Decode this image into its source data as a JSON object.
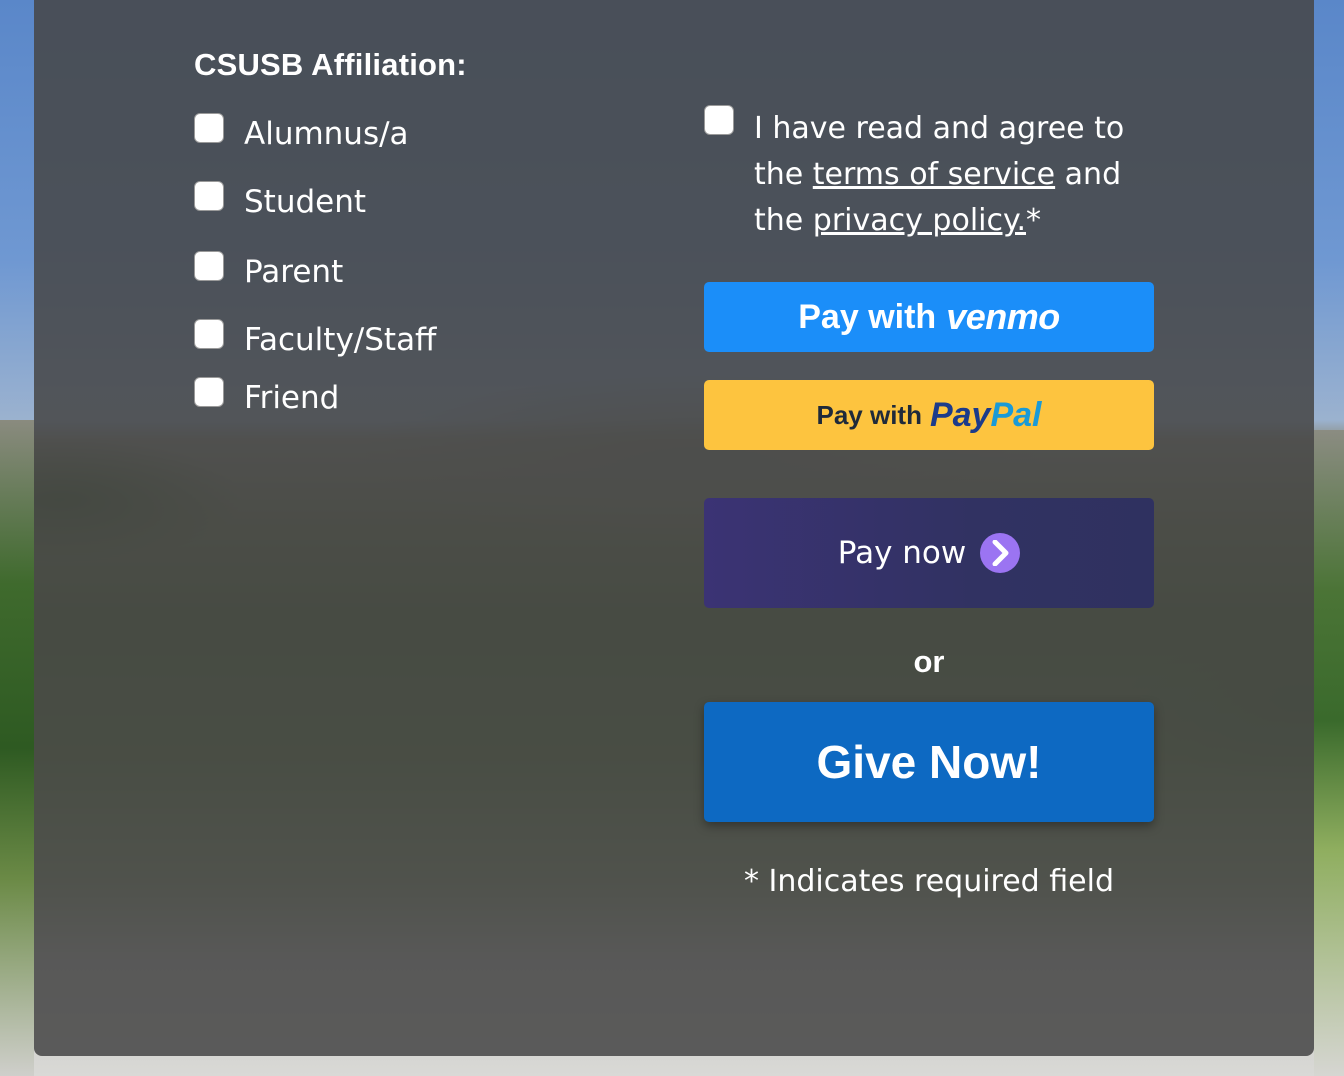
{
  "affiliation": {
    "title": "CSUSB Affiliation:",
    "options": [
      {
        "label": "Alumnus/a",
        "checked": false
      },
      {
        "label": "Student",
        "checked": false
      },
      {
        "label": "Parent",
        "checked": false
      },
      {
        "label": "Faculty/Staff",
        "checked": false
      },
      {
        "label": "Friend",
        "checked": false
      }
    ]
  },
  "terms": {
    "checked": false,
    "prefix": "I have read and agree to the",
    "terms_link": "terms of service",
    "middle": "and the",
    "privacy_link": "privacy policy.",
    "required_mark": "*"
  },
  "payments": {
    "venmo": {
      "prefix": "Pay with",
      "brand": "venmo",
      "color": "#1b8ef9"
    },
    "paypal": {
      "prefix": "Pay with",
      "brand_pay": "Pay",
      "brand_pal": "Pal",
      "color": "#fdc43f"
    },
    "paynow": {
      "label": "Pay now",
      "color": "#313262",
      "icon": "chevron-right-icon"
    }
  },
  "or_text": "or",
  "give_now": {
    "label": "Give Now!",
    "color": "#0d69c2"
  },
  "required_note": "* Indicates required field"
}
